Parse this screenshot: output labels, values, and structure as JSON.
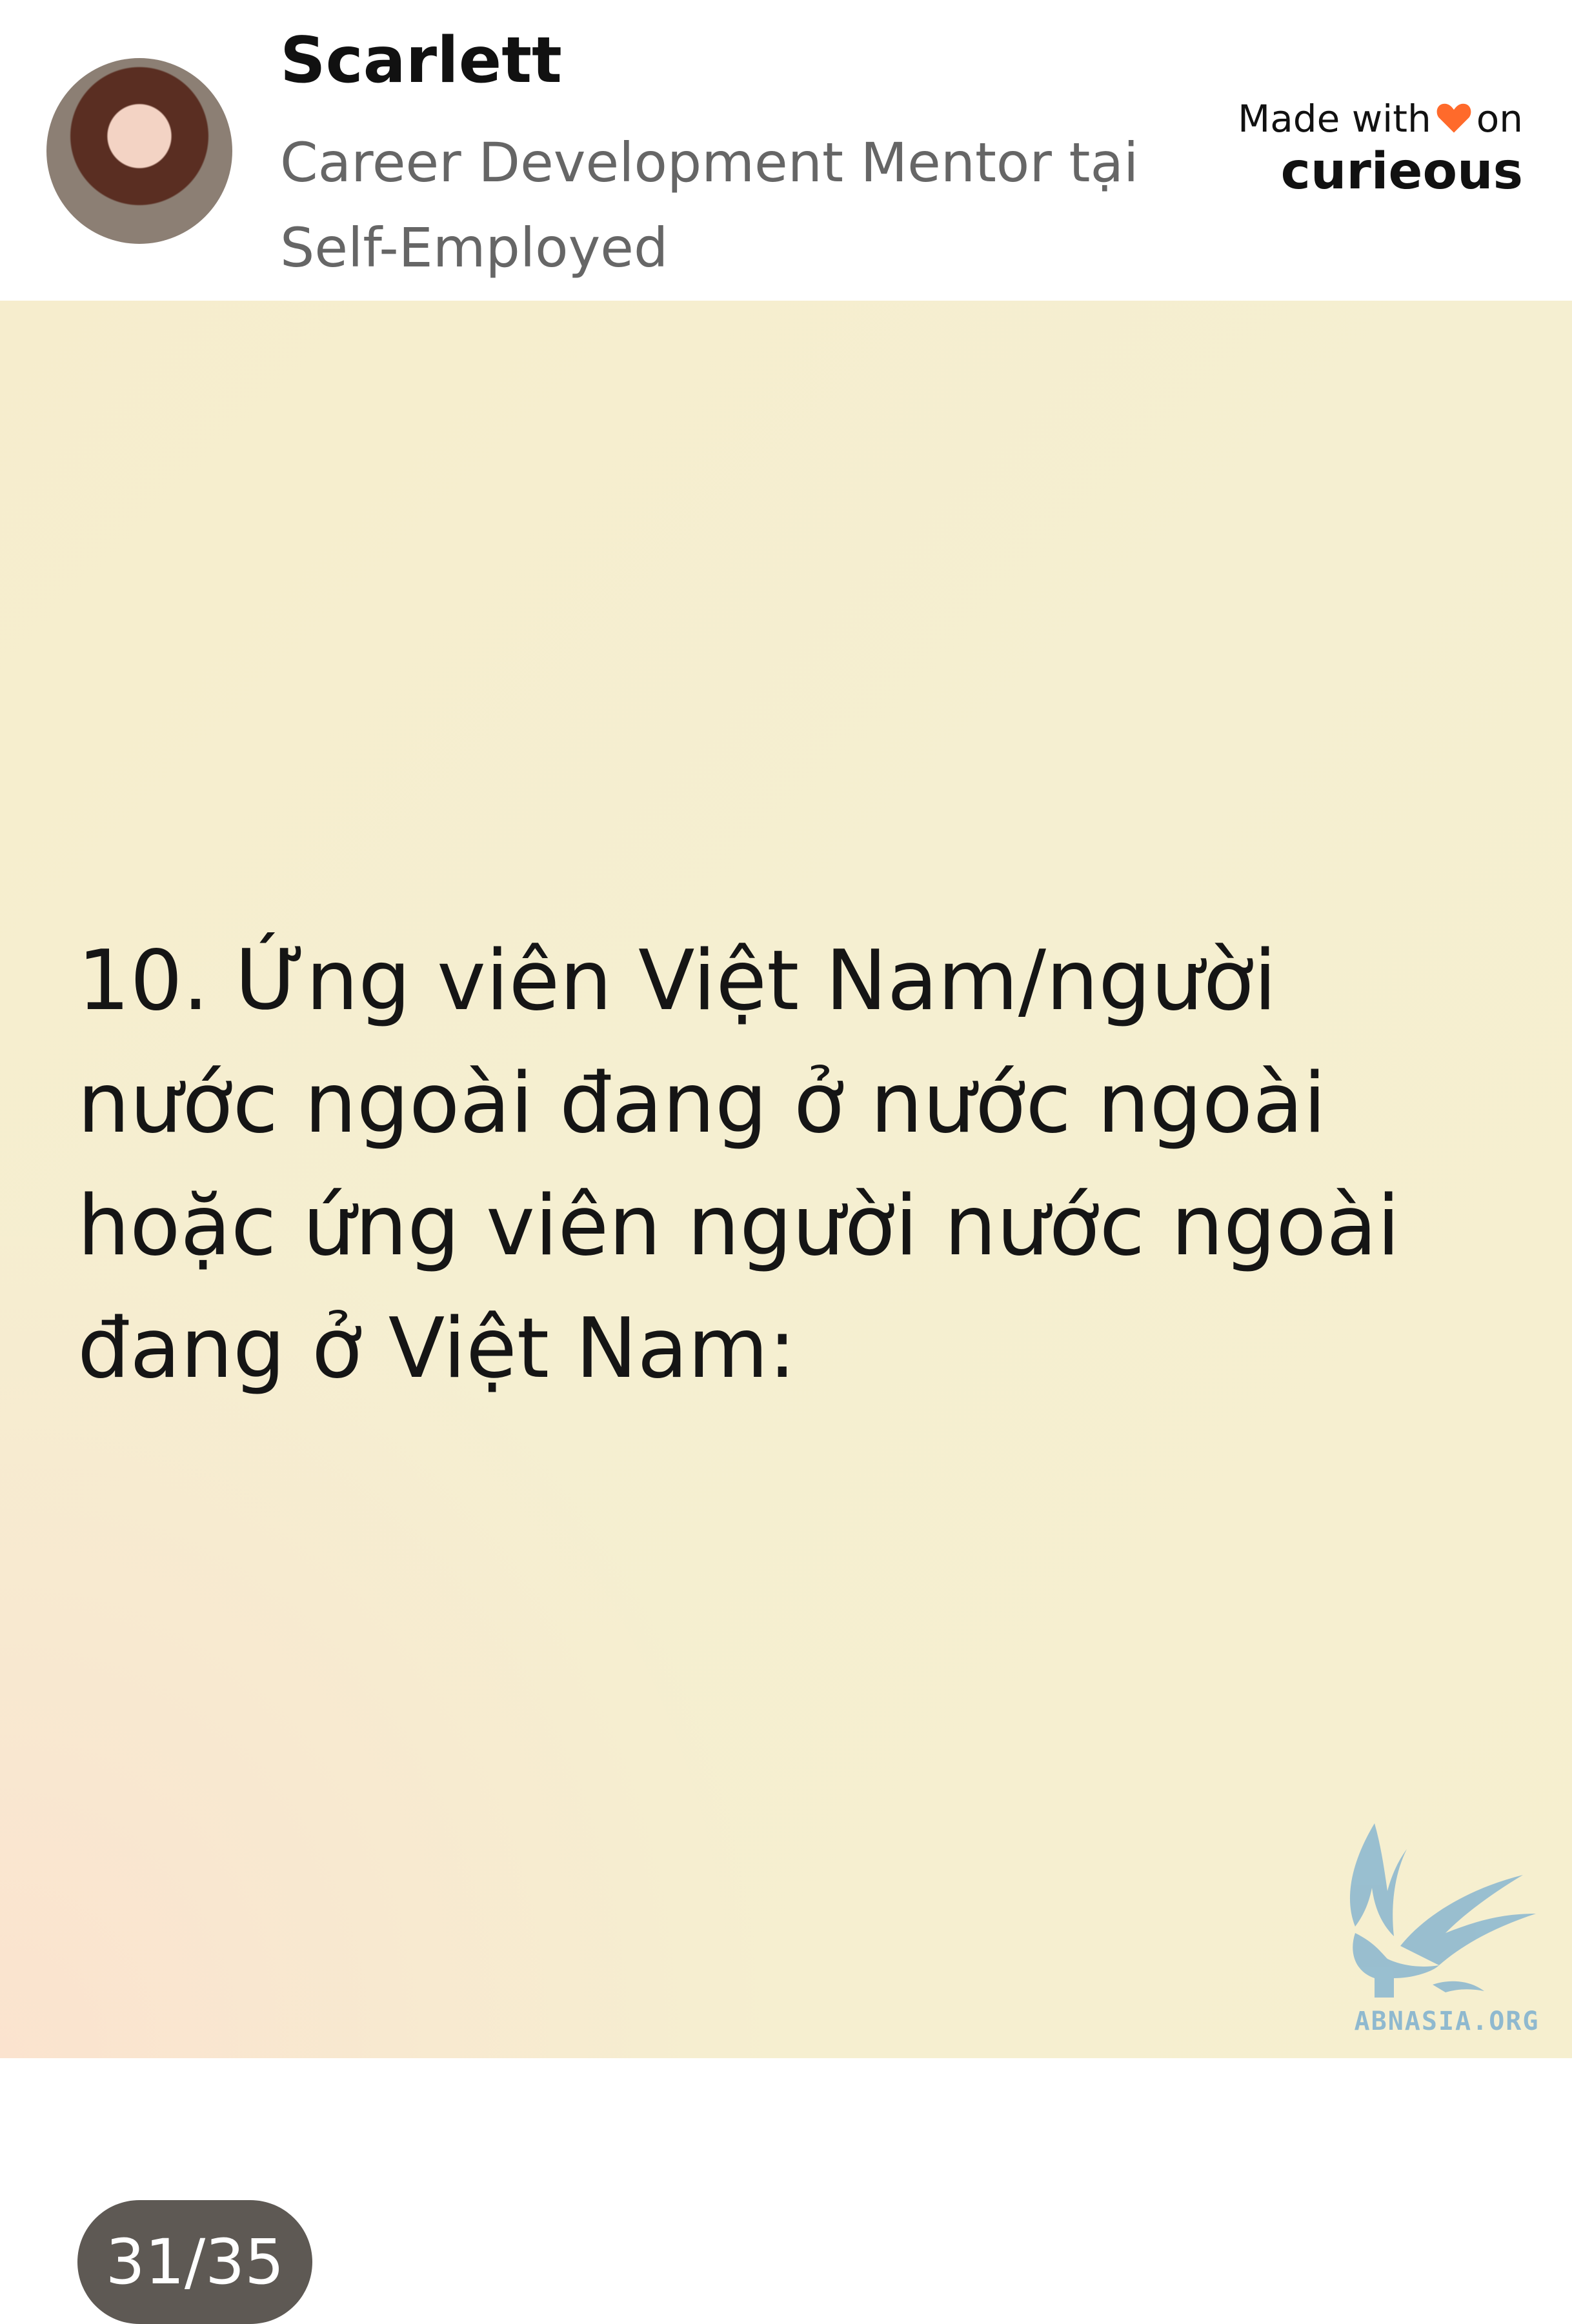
{
  "author": {
    "name": "Scarlett",
    "role": "Career Development Mentor tại Self-Employed",
    "avatar_icon": "profile-photo"
  },
  "brand": {
    "made_with": "Made with",
    "heart_icon": "heart-icon",
    "on": "on",
    "logo": "curieous",
    "heart_color": "#ff6a2b"
  },
  "slide": {
    "text": "10. Ứng viên Việt Nam/người nước ngoài đang ở nước ngoài hoặc ứng viên người nước ngoài đang ở Việt Nam:",
    "counter": "31/35"
  },
  "watermark": {
    "text": "ABNASIA.ORG",
    "icon": "griffin-logo-icon",
    "color": "#8fb9cf"
  }
}
